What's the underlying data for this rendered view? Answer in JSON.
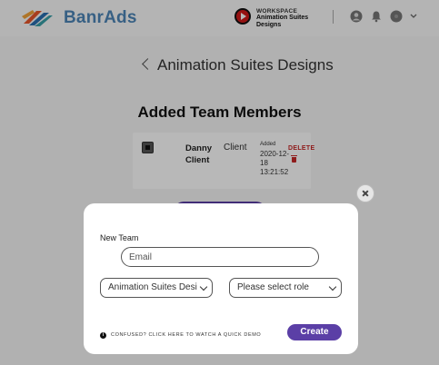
{
  "header": {
    "brand": "BanrAds",
    "workspace_caption": "WORKSPACE",
    "workspace_name": "Animation Suites Designs"
  },
  "page": {
    "back_title": "Animation Suites Designs",
    "section_title": "Added Team Members"
  },
  "members": [
    {
      "name": "Danny Client",
      "role": "Client",
      "added_label": "Added",
      "added_date": "2020-12-18 13:21:52",
      "delete_label": "DELETE"
    }
  ],
  "modal": {
    "title": "New Team",
    "email_placeholder": "Email",
    "team_select_value": "Animation Suites Desi",
    "role_select_value": "Please select role",
    "demo_link": "CONFUSED? CLICK HERE TO WATCH A QUICK DEMO",
    "create_label": "Create"
  },
  "icons": {
    "logo": "banrads-logo-icon",
    "workspace": "play-icon",
    "user": "user-icon",
    "bell": "bell-icon",
    "help": "help-icon",
    "chevron": "chevron-down-icon",
    "back": "chevron-left-icon",
    "info": "info-icon",
    "close": "close-icon",
    "trash": "trash-icon"
  },
  "colors": {
    "accent": "#5b3fa6",
    "brand": "#4d86b8",
    "danger": "#c62828"
  }
}
